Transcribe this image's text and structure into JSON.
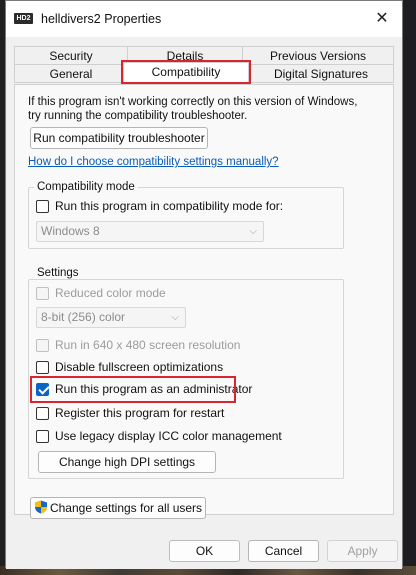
{
  "window": {
    "title": "helldivers2 Properties",
    "icon_text": "HD2"
  },
  "tabs": {
    "row1": [
      "Security",
      "Details",
      "Previous Versions"
    ],
    "row2": [
      "General",
      "Compatibility",
      "Digital Signatures"
    ],
    "active": "Compatibility"
  },
  "intro_text": {
    "line1": "If this program isn't working correctly on this version of Windows,",
    "line2": "try running the compatibility troubleshooter."
  },
  "troubleshooter_button": "Run compatibility troubleshooter",
  "manual_link": "How do I choose compatibility settings manually?",
  "compat_mode": {
    "group_label": "Compatibility mode",
    "checkbox_label": "Run this program in compatibility mode for:",
    "checked": false,
    "selected_os": "Windows 8"
  },
  "settings": {
    "group_label": "Settings",
    "reduced_color": {
      "label": "Reduced color mode",
      "checked": false,
      "enabled": false
    },
    "color_select": "8-bit (256) color",
    "resolution_640": {
      "label": "Run in 640 x 480 screen resolution",
      "checked": false,
      "enabled": false
    },
    "disable_fullscreen": {
      "label": "Disable fullscreen optimizations",
      "checked": false
    },
    "run_as_admin": {
      "label": "Run this program as an administrator",
      "checked": true
    },
    "register_restart": {
      "label": "Register this program for restart",
      "checked": false
    },
    "legacy_icc": {
      "label": "Use legacy display ICC color management",
      "checked": false
    },
    "high_dpi_button": "Change high DPI settings"
  },
  "all_users_button": "Change settings for all users",
  "footer": {
    "ok": "OK",
    "cancel": "Cancel",
    "apply": "Apply"
  },
  "colors": {
    "accent": "#0a63c9",
    "highlight": "#d7262f",
    "link": "#0b5cb8"
  },
  "icons": {
    "close": "close-icon",
    "shield": "uac-shield-icon",
    "dropdown": "chevron-down-icon"
  }
}
